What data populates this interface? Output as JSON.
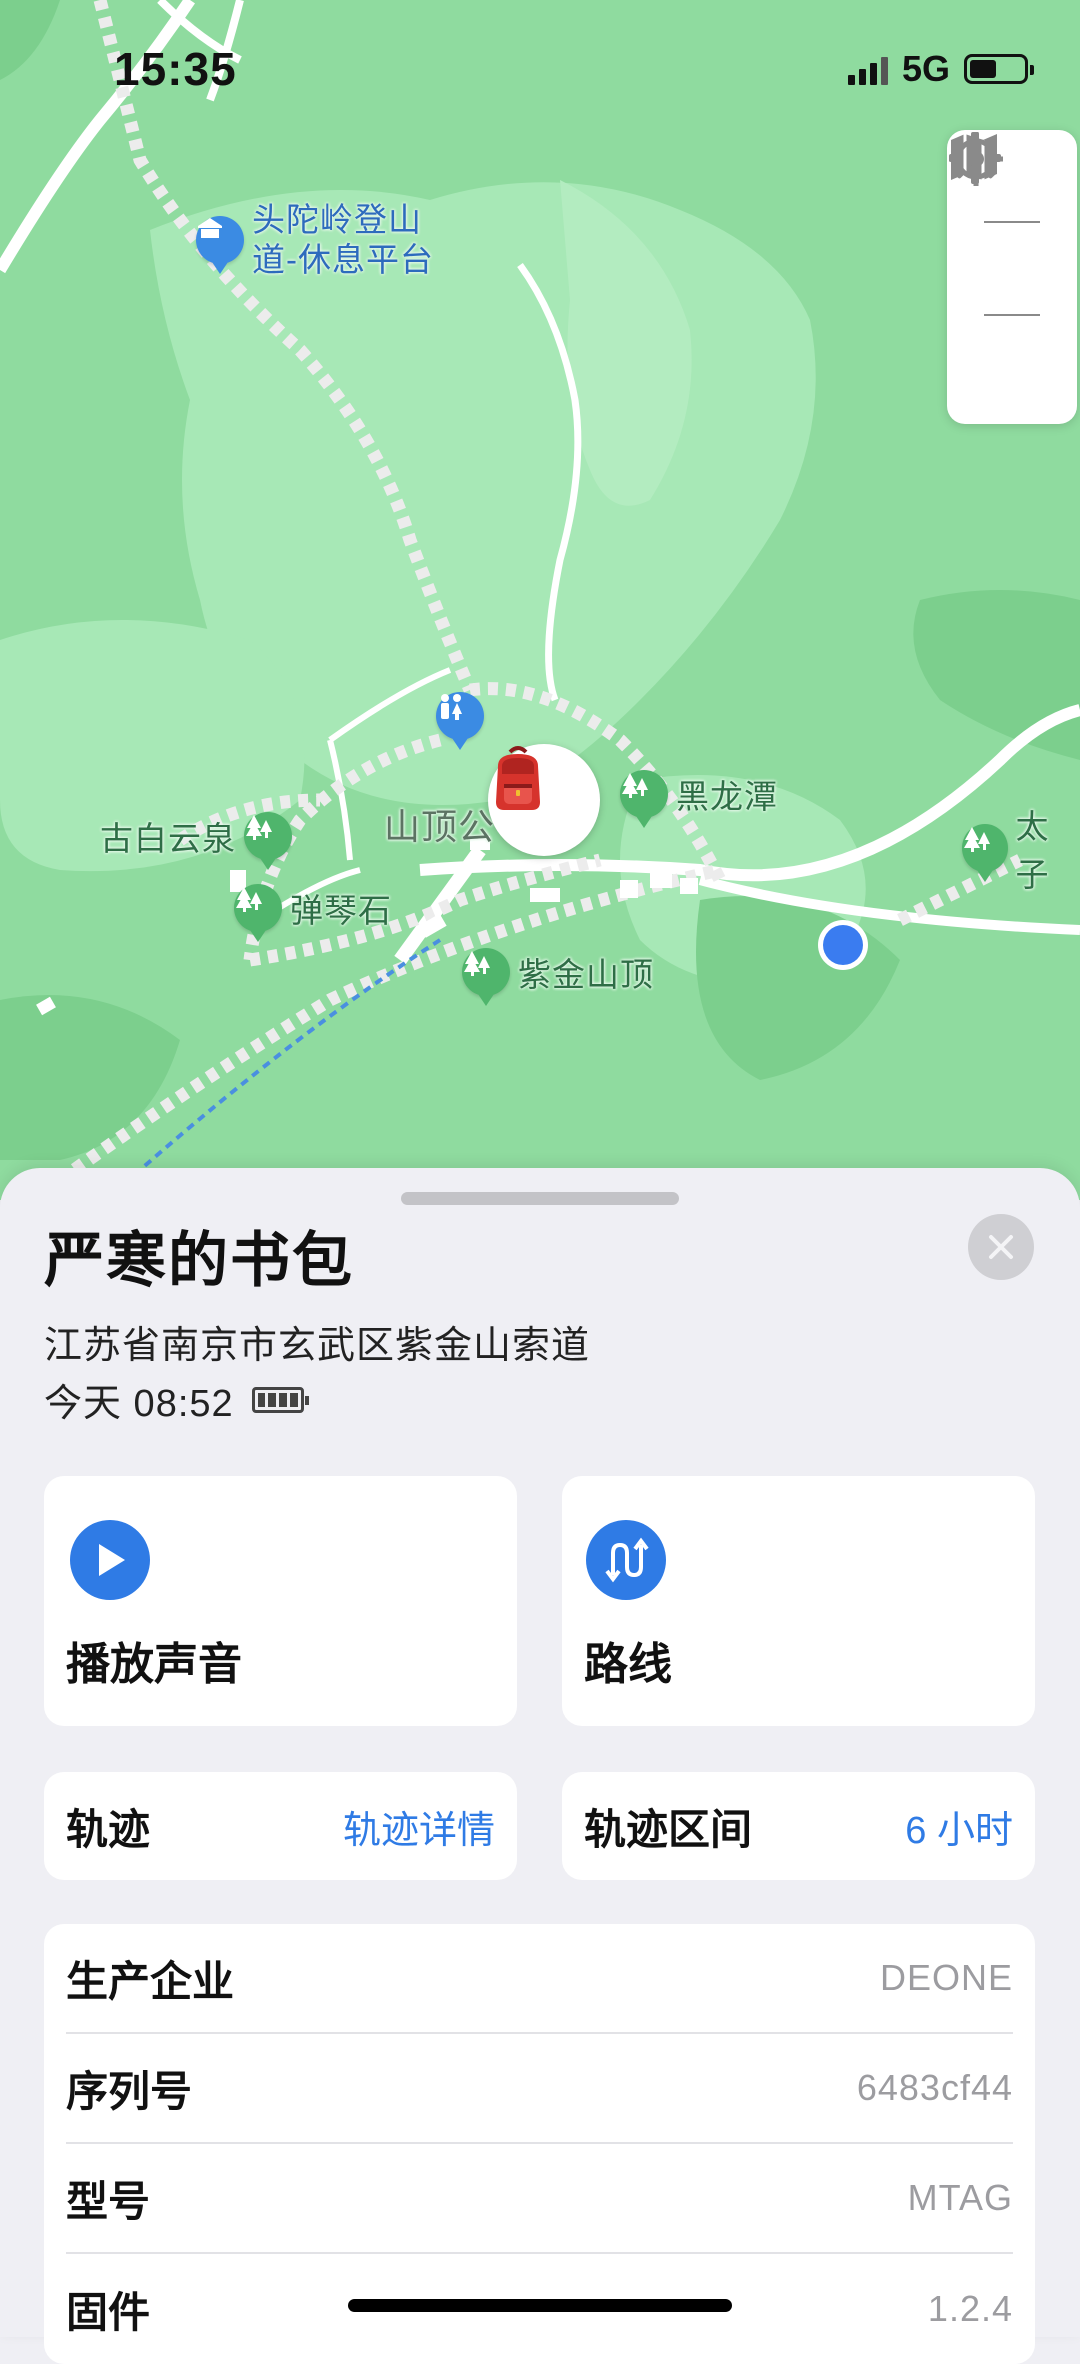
{
  "status_bar": {
    "time": "15:35",
    "network": "5G",
    "battery_level": 0.5
  },
  "map": {
    "pois": {
      "rest_platform": "头陀岭登山道-休息平台",
      "rest_platform_line1": "头陀岭登山",
      "rest_platform_line2": "道-休息平台",
      "heilongtan": "黑龙潭",
      "guboiyunquan": "古白云泉",
      "tanqinshi": "弹琴石",
      "zijinshanding": "紫金山顶",
      "taizi": "太子",
      "shanding": "山顶公"
    },
    "controls": [
      "gear-icon",
      "map-icon",
      "locate-icon"
    ],
    "colors": {
      "land": "#8fdb9f",
      "forest_dark": "#7ccf8d",
      "forest_light": "#a7e8b6",
      "road": "#ffffff",
      "poi_green": "#4fb56c",
      "poi_blue": "#3b8be3",
      "user_dot": "#3a7cf0"
    }
  },
  "sheet": {
    "title": "严寒的书包",
    "address": "江苏省南京市玄武区紫金山索道",
    "time": "今天 08:52",
    "actions": [
      {
        "label": "播放声音",
        "icon": "play-icon"
      },
      {
        "label": "路线",
        "icon": "route-icon"
      }
    ],
    "track": {
      "title": "轨迹",
      "link": "轨迹详情"
    },
    "track_range": {
      "title": "轨迹区间",
      "value": "6 小时"
    },
    "info": [
      {
        "key": "生产企业",
        "value": "DEONE"
      },
      {
        "key": "序列号",
        "value": "6483cf44"
      },
      {
        "key": "型号",
        "value": "MTAG"
      },
      {
        "key": "固件",
        "value": "1.2.4"
      }
    ],
    "accent": "#2f7be5"
  }
}
